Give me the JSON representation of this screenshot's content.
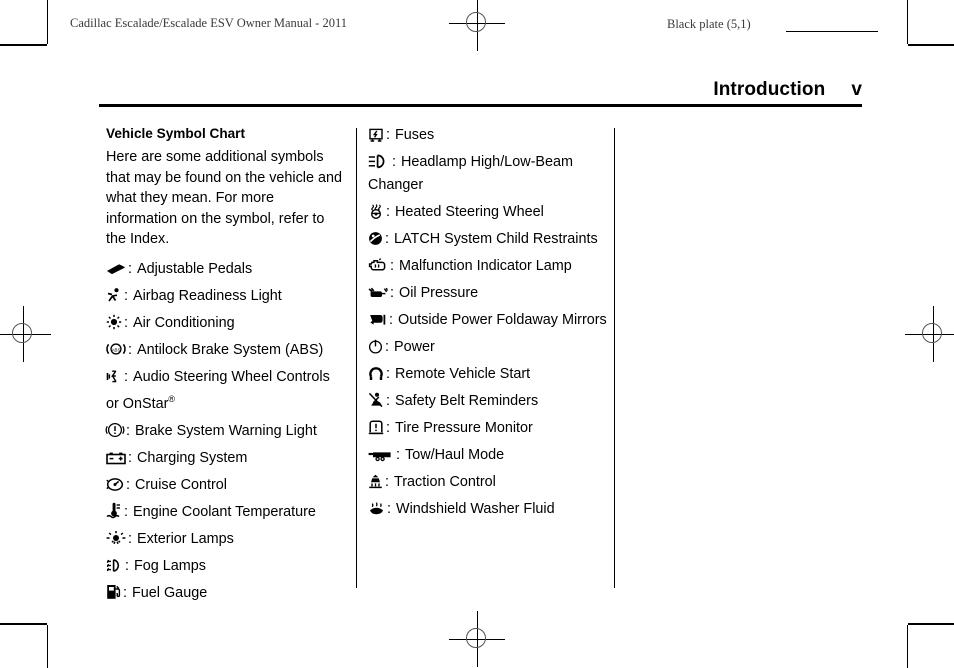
{
  "page": {
    "running_head_left": "Cadillac Escalade/Escalade ESV Owner Manual - 2011",
    "running_head_right": "Black plate (5,1)",
    "section_title": "Introduction",
    "page_number": "v"
  },
  "content": {
    "subhead": "Vehicle Symbol Chart",
    "intro": "Here are some additional symbols that may be found on the vehicle and what they mean. For more information on the symbol, refer to the Index.",
    "colon": ":",
    "left_column": [
      {
        "icon": "adjustable-pedals-icon",
        "label": "Adjustable Pedals"
      },
      {
        "icon": "airbag-readiness-icon",
        "label": "Airbag Readiness Light"
      },
      {
        "icon": "air-conditioning-icon",
        "label": "Air Conditioning"
      },
      {
        "icon": "antilock-brake-icon",
        "label": "Antilock Brake System (ABS)"
      },
      {
        "icon": "audio-steering-wheel-icon",
        "label": "Audio Steering Wheel Controls or OnStar",
        "suffix": "®"
      },
      {
        "icon": "brake-warning-icon",
        "label": "Brake System Warning Light"
      },
      {
        "icon": "charging-system-icon",
        "label": "Charging System"
      },
      {
        "icon": "cruise-control-icon",
        "label": "Cruise Control"
      },
      {
        "icon": "engine-coolant-temp-icon",
        "label": "Engine Coolant Temperature"
      },
      {
        "icon": "exterior-lamps-icon",
        "label": "Exterior Lamps"
      },
      {
        "icon": "fog-lamps-icon",
        "label": "Fog Lamps"
      },
      {
        "icon": "fuel-gauge-icon",
        "label": "Fuel Gauge"
      }
    ],
    "right_column": [
      {
        "icon": "fuses-icon",
        "label": "Fuses"
      },
      {
        "icon": "headlamp-beam-icon",
        "label": "Headlamp High/Low-Beam Changer"
      },
      {
        "icon": "heated-steering-wheel-icon",
        "label": "Heated Steering Wheel"
      },
      {
        "icon": "latch-child-restraint-icon",
        "label": "LATCH System Child Restraints"
      },
      {
        "icon": "malfunction-indicator-icon",
        "label": "Malfunction Indicator Lamp"
      },
      {
        "icon": "oil-pressure-icon",
        "label": "Oil Pressure"
      },
      {
        "icon": "outside-power-mirrors-icon",
        "label": "Outside Power Foldaway Mirrors"
      },
      {
        "icon": "power-icon",
        "label": "Power"
      },
      {
        "icon": "remote-vehicle-start-icon",
        "label": "Remote Vehicle Start"
      },
      {
        "icon": "safety-belt-reminder-icon",
        "label": "Safety Belt Reminders"
      },
      {
        "icon": "tire-pressure-monitor-icon",
        "label": "Tire Pressure Monitor"
      },
      {
        "icon": "tow-haul-mode-icon",
        "label": "Tow/Haul Mode"
      },
      {
        "icon": "traction-control-icon",
        "label": "Traction Control"
      },
      {
        "icon": "windshield-washer-fluid-icon",
        "label": "Windshield Washer Fluid"
      }
    ]
  }
}
